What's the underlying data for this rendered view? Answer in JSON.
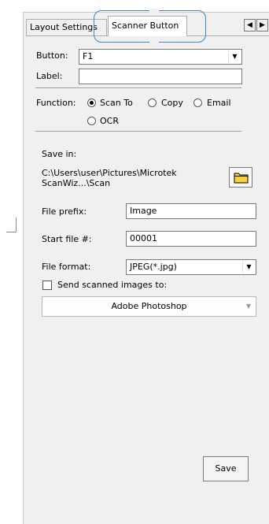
{
  "tabs": [
    {
      "label": "Layout Settings",
      "active": false
    },
    {
      "label": "Scanner Button",
      "active": true
    }
  ],
  "scroll_arrows": {
    "left": "◀",
    "right": "▶"
  },
  "button_field": {
    "label": "Button:",
    "value": "F1"
  },
  "label_field": {
    "label": "Label:",
    "value": ""
  },
  "function": {
    "label": "Function:",
    "options": [
      "Scan To",
      "Copy",
      "Email",
      "OCR"
    ],
    "selected": "Scan To"
  },
  "save_in": {
    "label": "Save in:",
    "path_line1": "C:\\Users\\user\\Pictures\\Microtek",
    "path_line2": "ScanWiz...\\Scan",
    "icon": "folder-icon"
  },
  "file_prefix": {
    "label": "File prefix:",
    "value": "Image"
  },
  "start_file": {
    "label": "Start file #:",
    "value": "00001"
  },
  "file_format": {
    "label": "File format:",
    "value": "JPEG(*.jpg)"
  },
  "send_images": {
    "label": "Send scanned images to:",
    "checked": false
  },
  "target_app": {
    "value": "Adobe Photoshop"
  },
  "save_button": {
    "label": "Save"
  },
  "colors": {
    "focus_ring": "#3a86d2",
    "panel_bg": "#f0f0f0"
  }
}
